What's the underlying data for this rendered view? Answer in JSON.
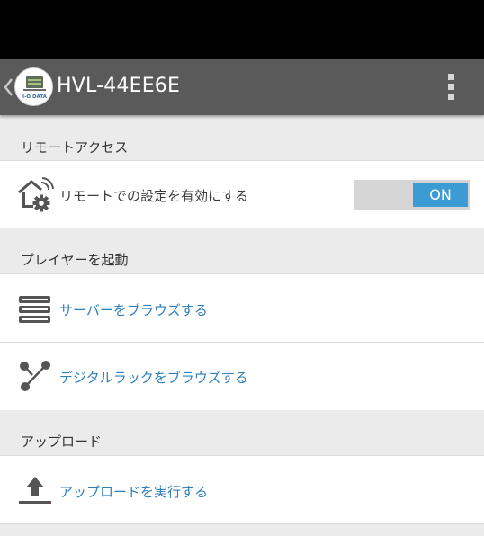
{
  "action_bar": {
    "title": "HVL-44EE6E",
    "logo_text": "I-O DATA"
  },
  "sections": [
    {
      "header": "リモートアクセス",
      "items": [
        {
          "label": "リモートでの設定を有効にする",
          "icon": "remote-settings-icon",
          "toggle": "ON"
        }
      ]
    },
    {
      "header": "プレイヤーを起動",
      "items": [
        {
          "label": "サーバーをブラウズする",
          "icon": "server-icon"
        },
        {
          "label": "デジタルラックをブラウズする",
          "icon": "share-nodes-icon"
        }
      ]
    },
    {
      "header": "アップロード",
      "items": [
        {
          "label": "アップロードを実行する",
          "icon": "upload-icon"
        }
      ]
    }
  ],
  "colors": {
    "action_bar": "#5a5a5a",
    "accent": "#3d9bd3",
    "link_text": "#2f7fbd",
    "section_bg": "#ebebeb"
  }
}
